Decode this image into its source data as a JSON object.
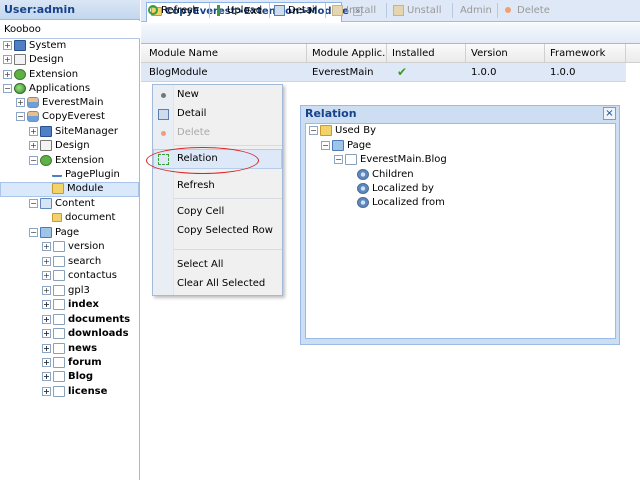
{
  "left_panel": {
    "title": "User:admin",
    "collapse_glyph": "«",
    "site": "Kooboo",
    "site_toggle": "−",
    "tree": [
      {
        "label": "System",
        "icon": "monitor-icon",
        "toggle": "+"
      },
      {
        "label": "Design",
        "icon": "design-icon",
        "toggle": "+"
      },
      {
        "label": "Extension",
        "icon": "extension-icon",
        "toggle": "+"
      },
      {
        "label": "Applications",
        "icon": "globe-icon",
        "toggle": "−"
      },
      {
        "label": "EverestMain",
        "icon": "user-icon",
        "toggle": "+"
      },
      {
        "label": "CopyEverest",
        "icon": "user-icon",
        "toggle": "−"
      },
      {
        "label": "SiteManager",
        "icon": "monitor-icon",
        "toggle": "+"
      },
      {
        "label": "Design",
        "icon": "design-icon",
        "toggle": "+"
      },
      {
        "label": "Extension",
        "icon": "extension-icon",
        "toggle": "−"
      },
      {
        "label": "PagePlugin",
        "icon": "arrow-icon",
        "toggle": ""
      },
      {
        "label": "Module",
        "icon": "folder-icon",
        "toggle": ""
      },
      {
        "label": "Content",
        "icon": "content-icon",
        "toggle": "−"
      },
      {
        "label": "document",
        "icon": "folder-icon",
        "toggle": ""
      },
      {
        "label": "Page",
        "icon": "page-icon",
        "toggle": "−"
      },
      {
        "label": "version",
        "icon": "doc-icon",
        "toggle": "+"
      },
      {
        "label": "search",
        "icon": "doc-icon",
        "toggle": "+"
      },
      {
        "label": "contactus",
        "icon": "doc-icon",
        "toggle": "+"
      },
      {
        "label": "gpl3",
        "icon": "doc-icon",
        "toggle": "+"
      },
      {
        "label": "index",
        "icon": "doc-icon",
        "toggle": "+"
      },
      {
        "label": "documents",
        "icon": "doc-icon",
        "toggle": "+"
      },
      {
        "label": "downloads",
        "icon": "doc-icon",
        "toggle": "+"
      },
      {
        "label": "news",
        "icon": "doc-icon",
        "toggle": "+"
      },
      {
        "label": "forum",
        "icon": "doc-icon",
        "toggle": "+"
      },
      {
        "label": "Blog",
        "icon": "doc-icon",
        "toggle": "+"
      },
      {
        "label": "license",
        "icon": "doc-icon",
        "toggle": "+"
      }
    ]
  },
  "tab": {
    "label": "CopyEverest>Extension>Module",
    "close_glyph": "×"
  },
  "toolbar": {
    "refresh": "Refresh",
    "upload": "Upload",
    "detail": "Detail",
    "install": "Install",
    "unstall": "Unstall",
    "admin": "Admin",
    "delete": "Delete"
  },
  "grid": {
    "columns": [
      "Module Name",
      "Module Applic...",
      "Installed",
      "Version",
      "Framework"
    ],
    "rows": [
      {
        "name": "BlogModule",
        "application": "EverestMain",
        "installed": "✔",
        "version": "1.0.0",
        "framework": "1.0.0"
      }
    ]
  },
  "context_menu": {
    "items": [
      "New",
      "Detail",
      "Delete",
      "Relation",
      "Refresh",
      "Copy Cell",
      "Copy Selected Row",
      "Select All",
      "Clear All Selected"
    ]
  },
  "relation_window": {
    "title": "Relation",
    "close_glyph": "×",
    "tree": [
      {
        "label": "Used By",
        "toggle": "−"
      },
      {
        "label": "Page",
        "toggle": "−"
      },
      {
        "label": "EverestMain.Blog",
        "toggle": "−"
      },
      {
        "label": "Children",
        "toggle": ""
      },
      {
        "label": "Localized by",
        "toggle": ""
      },
      {
        "label": "Localized from",
        "toggle": ""
      }
    ]
  },
  "colors": {
    "panel_header": "#15428b",
    "selection": "#dfe8f6",
    "highlight_oval": "#e02020"
  }
}
